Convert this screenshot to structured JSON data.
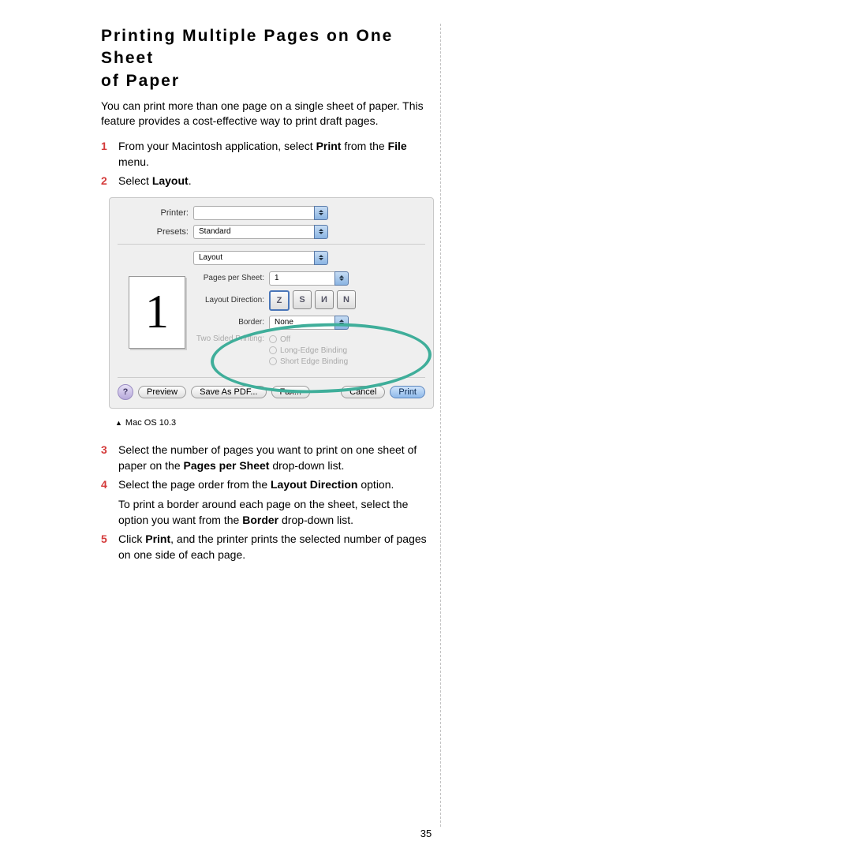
{
  "title_line1": "Printing Multiple Pages on One Sheet",
  "title_line2": "of Paper",
  "intro": "You can print more than one page on a single sheet of paper. This feature provides a cost-effective way to print draft pages.",
  "steps": {
    "s1_a": "From your Macintosh application, select ",
    "s1_b": "Print",
    "s1_c": " from the ",
    "s1_d": "File",
    "s1_e": " menu.",
    "s2_a": "Select ",
    "s2_b": "Layout",
    "s2_c": ".",
    "s3_a": "Select the number of pages you want to print on one sheet of paper on the ",
    "s3_b": "Pages per Sheet",
    "s3_c": " drop-down list.",
    "s4_a": "Select the page order from the ",
    "s4_b": "Layout Direction",
    "s4_c": " option.",
    "s4_p": "To print a border around each page on the sheet, select the option you want from the ",
    "s4_pb": "Border",
    "s4_pc": " drop-down list.",
    "s5_a": "Click ",
    "s5_b": "Print",
    "s5_c": ", and the printer prints the selected number of pages on one side of each page."
  },
  "dialog": {
    "printer_label": "Printer:",
    "printer_value": "",
    "presets_label": "Presets:",
    "presets_value": "Standard",
    "section_value": "Layout",
    "pps_label": "Pages per Sheet:",
    "pps_value": "1",
    "dir_label": "Layout Direction:",
    "dir_glyphs": {
      "a": "Z",
      "b": "S",
      "c": "И",
      "d": "N"
    },
    "border_label": "Border:",
    "border_value": "None",
    "twosided_label": "Two Sided Printing:",
    "twosided_opts": {
      "off": "Off",
      "long": "Long-Edge Binding",
      "short": "Short Edge Binding"
    },
    "preview_glyph": "1",
    "buttons": {
      "help": "?",
      "preview": "Preview",
      "savepdf": "Save As PDF...",
      "fax": "Fax...",
      "cancel": "Cancel",
      "print": "Print"
    }
  },
  "caption": "Mac OS 10.3",
  "page_number": "35"
}
